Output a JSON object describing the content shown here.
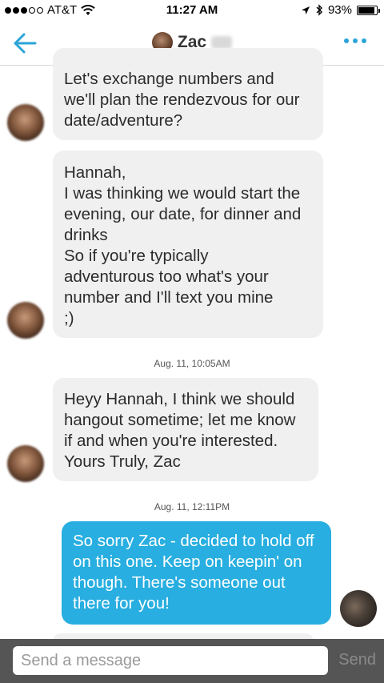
{
  "status_bar": {
    "carrier": "AT&T",
    "time": "11:27 AM",
    "battery": "93%",
    "battery_level": 0.93
  },
  "header": {
    "contact_name": "Zac"
  },
  "messages": [
    {
      "text": "Let's exchange numbers and\nwe'll plan the rendezvous for our\ndate/adventure?"
    },
    {
      "text": "Hannah,\nI was thinking we would start the\nevening, our date, for dinner and\ndrinks\nSo if you're typically\nadventurous too what's your\nnumber and I'll text you mine\n;)"
    },
    {
      "timestamp": "Aug. 11, 10:05AM",
      "text": "Heyy Hannah, I think we should\nhangout sometime; let me know\nif and when you're interested.\nYours Truly, Zac"
    },
    {
      "timestamp": "Aug. 11, 12:11PM",
      "text": "So sorry Zac - decided to hold off\non this one. Keep on keepin' on\nthough. There's someone out\nthere for you!"
    }
  ],
  "composer": {
    "placeholder": "Send a message",
    "send_label": "Send"
  },
  "colors": {
    "accent": "#2ba4d8",
    "outgoing_bubble": "#28aee0",
    "incoming_bubble": "#f0f0f0",
    "input_bar": "#555555"
  },
  "icons": [
    "signal-dots-icon",
    "wifi-icon",
    "location-arrow-icon",
    "bluetooth-icon",
    "battery-icon",
    "back-arrow-icon",
    "more-options-icon"
  ]
}
